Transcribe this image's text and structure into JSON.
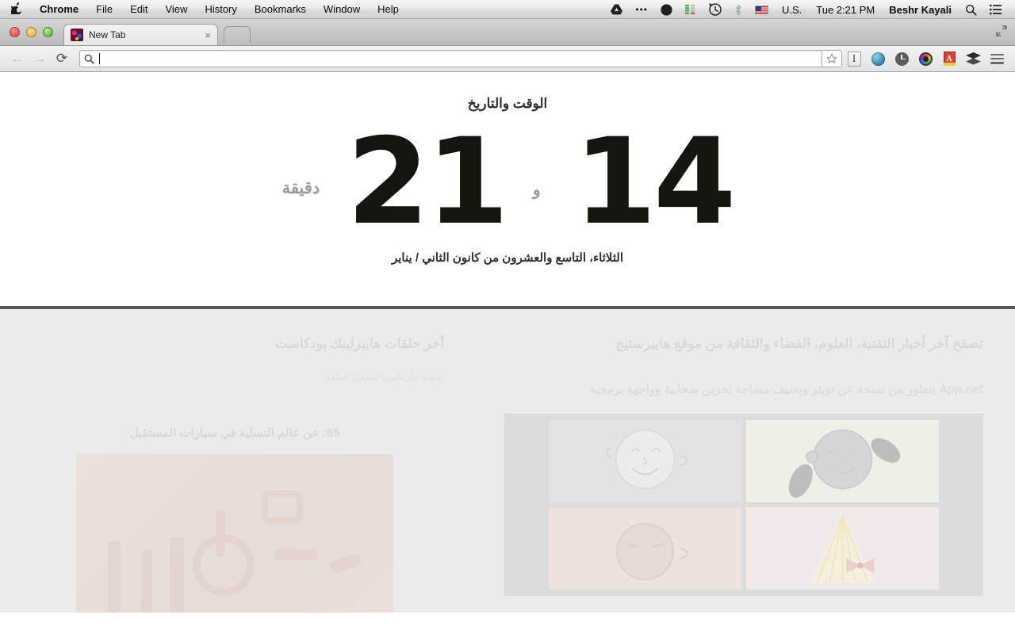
{
  "os_menubar": {
    "apple_glyph": "●",
    "items": [
      {
        "label": "Chrome",
        "bold": true
      },
      {
        "label": "File",
        "bold": false
      },
      {
        "label": "Edit",
        "bold": false
      },
      {
        "label": "View",
        "bold": false
      },
      {
        "label": "History",
        "bold": false
      },
      {
        "label": "Bookmarks",
        "bold": false
      },
      {
        "label": "Window",
        "bold": false
      },
      {
        "label": "Help",
        "bold": false
      }
    ],
    "status_icons": [
      {
        "name": "google-drive-icon"
      },
      {
        "name": "overflow-dots-icon",
        "glyph": "•••"
      },
      {
        "name": "dropbox-moon-icon"
      },
      {
        "name": "signal-bars-icon"
      },
      {
        "name": "time-machine-icon"
      },
      {
        "name": "bluetooth-icon",
        "glyph": "ᛒ"
      }
    ],
    "input_flag": "flag-us-icon",
    "input_source": "U.S.",
    "clock": "Tue 2:21 PM",
    "user": "Beshr Kayali",
    "spotlight_icon": "search-icon",
    "notification_icon": "notification-center-icon"
  },
  "browser": {
    "window_controls": [
      "close",
      "minimize",
      "zoom"
    ],
    "tab": {
      "title": "New Tab",
      "close_glyph": "×",
      "favicon": "hyperlink-favicon"
    },
    "new_tab_button": "+",
    "expand_glyph": "⤡",
    "toolbar": {
      "back_glyph": "←",
      "forward_glyph": "→",
      "reload_glyph": "⟳",
      "omnibox_value": "",
      "omnibox_placeholder": "",
      "omnibox_search_icon": "search-icon",
      "bookmark_star_glyph": "☆",
      "extensions": [
        {
          "name": "instapaper-extension-icon",
          "glyph": "I"
        },
        {
          "name": "globe-extension-icon",
          "glyph": ""
        },
        {
          "name": "clock-extension-icon",
          "glyph": ""
        },
        {
          "name": "camera-extension-icon",
          "glyph": ""
        },
        {
          "name": "dictionary-extension-icon",
          "glyph": "A"
        },
        {
          "name": "buffer-extension-icon",
          "glyph": ""
        },
        {
          "name": "chrome-menu-icon",
          "glyph": ""
        }
      ]
    }
  },
  "newtab_page": {
    "clock_widget": {
      "title": "الوقت والتاريخ",
      "hour": "14",
      "conjunction": "و",
      "minute": "21",
      "unit_label": "دقيقة",
      "date": "الثلاثاء، التاسع والعشرون من كانون الثاني / يناير"
    },
    "news_column": {
      "heading": "تصفح آخر أخبار التقنية، العلوم، الفضاء والثقافة من موقع هايبرستيج",
      "article_title": "App.net يتطور من نسخة عن تويتر ويضيف مساحة تخزين سحابية وواجهة برمجية",
      "article_thumbnail": "appnet-avatars-thumbnail"
    },
    "podcast_column": {
      "heading": "آخر حلقات هايبرلينك بودكاست",
      "subtitle": "إضغط على الصور لتشغيل الحلقة",
      "episode_title": "85: عن عالم التسلية في سيارات المستقبل",
      "episode_thumbnail": "podcast-episode-thumbnail"
    }
  },
  "colors": {
    "page_bg": "#ffffff",
    "faded_bg": "#ebebeb",
    "divider": "#57575a",
    "clock_digits": "#15150f",
    "muted_text": "#9b9b9b",
    "faded_text": "#d9d9d9"
  }
}
